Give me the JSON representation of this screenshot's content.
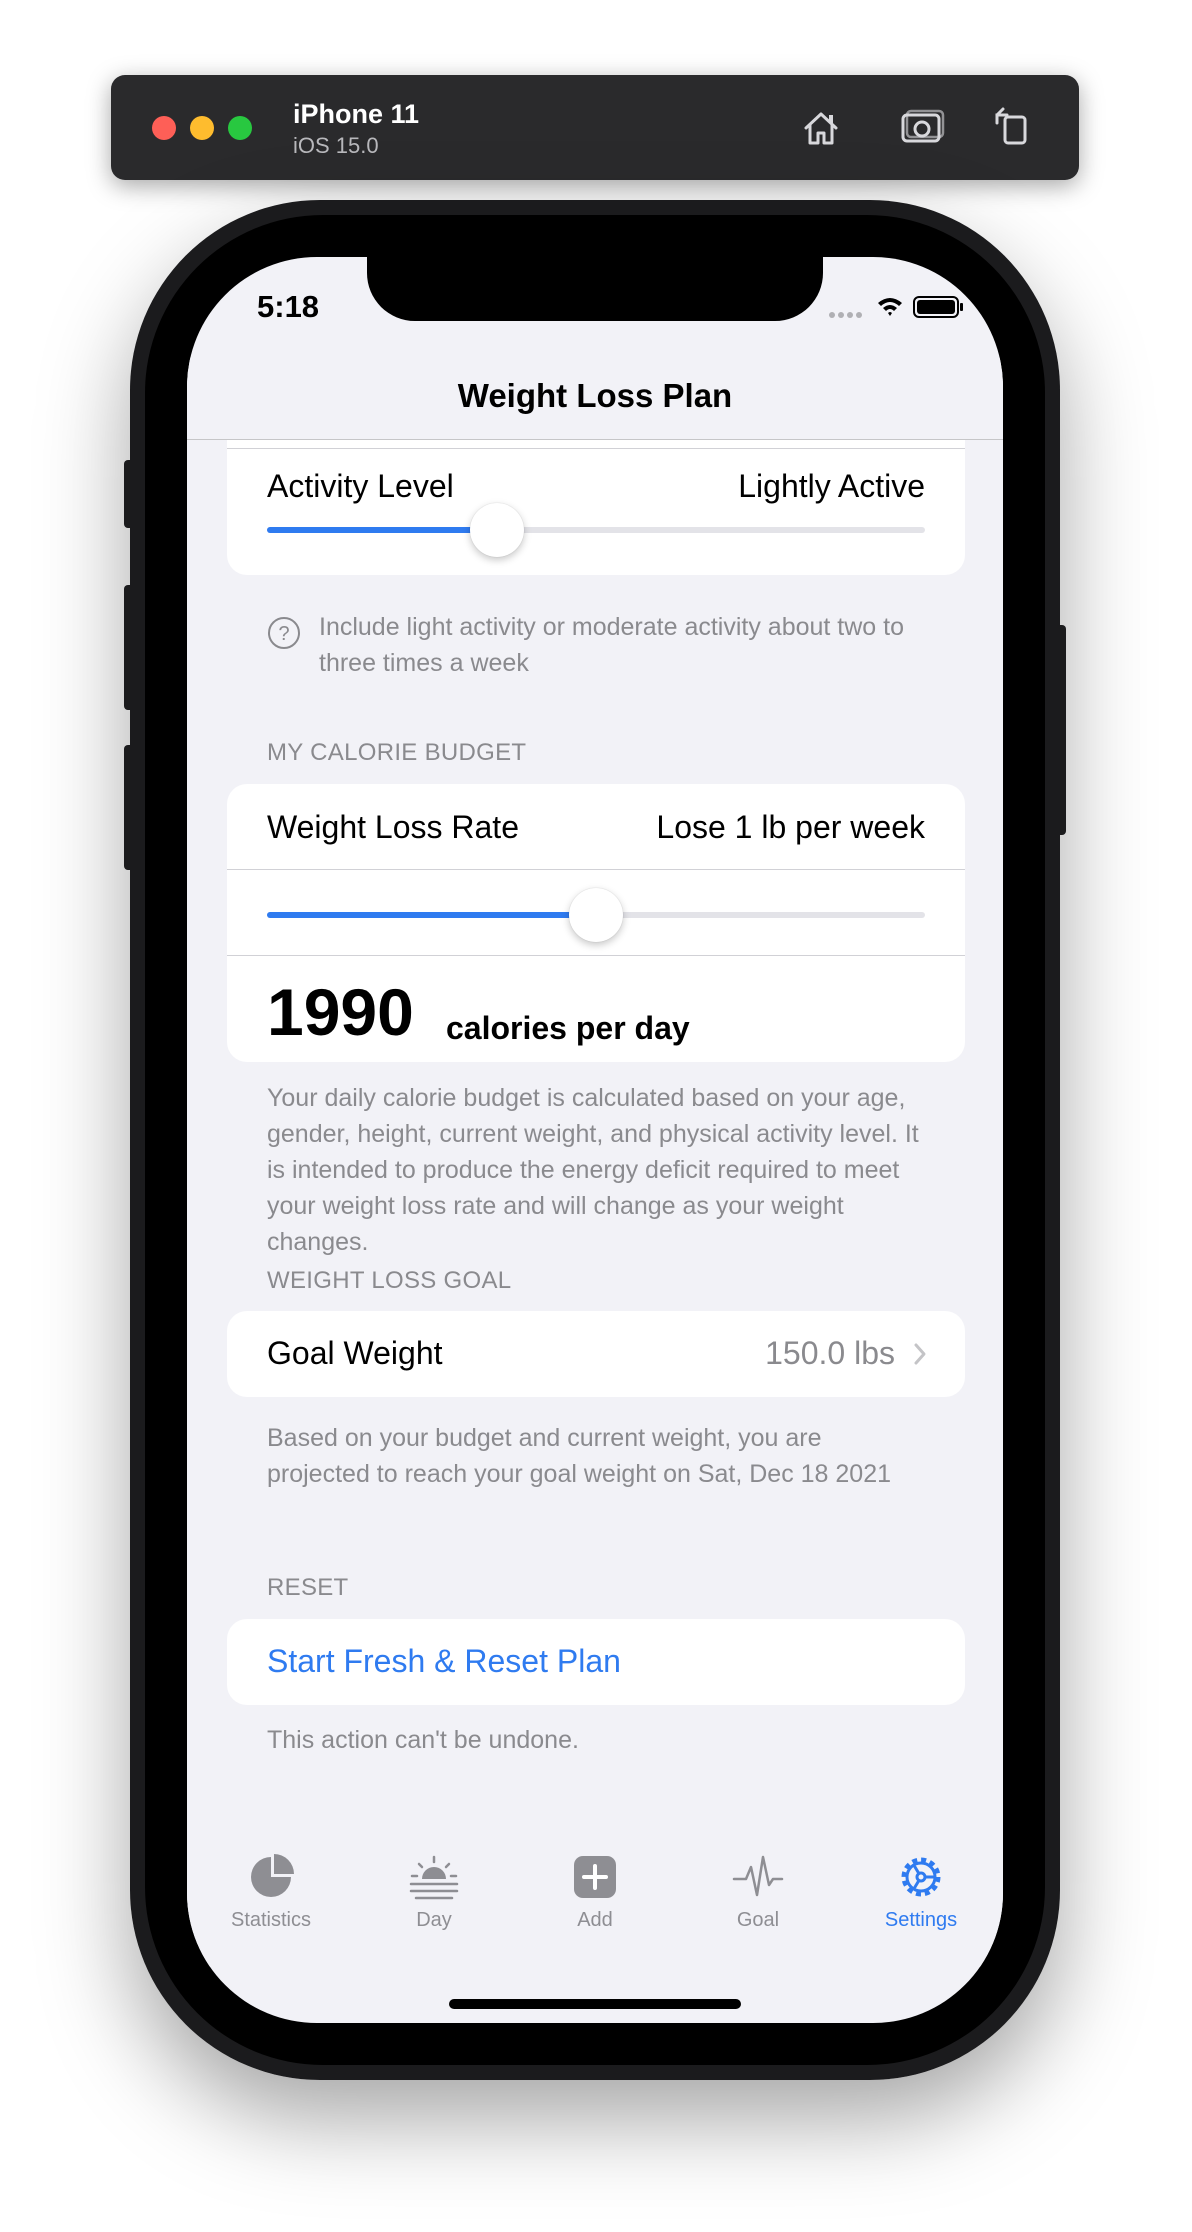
{
  "simulator": {
    "device_name": "iPhone 11",
    "os_version": "iOS 15.0",
    "buttons": [
      "home-icon",
      "screenshot-icon",
      "rotate-icon"
    ]
  },
  "status_bar": {
    "time": "5:18"
  },
  "nav": {
    "title": "Weight Loss Plan"
  },
  "activity": {
    "label": "Activity Level",
    "value": "Lightly Active",
    "slider_fraction": 0.35,
    "help_icon": "question-circle-icon",
    "help_text": "Include light activity or moderate activity about two to three times a week"
  },
  "calorie_budget": {
    "header": "MY CALORIE BUDGET",
    "rate_label": "Weight Loss Rate",
    "rate_value": "Lose 1 lb per week",
    "slider_fraction": 0.5,
    "calories": "1990",
    "calories_unit": "calories per day",
    "footnote": "Your daily calorie budget is calculated based on your age, gender, height, current weight, and physical activity level. It is intended to produce the energy deficit required to meet your weight loss rate and will change as your weight changes."
  },
  "goal": {
    "header": "WEIGHT LOSS GOAL",
    "label": "Goal Weight",
    "value": "150.0 lbs",
    "footnote": "Based on your budget and current weight, you are projected to reach your goal weight on Sat, Dec 18 2021"
  },
  "reset": {
    "header": "RESET",
    "button_label": "Start Fresh & Reset Plan",
    "footnote": "This action can't be undone."
  },
  "tabs": [
    {
      "label": "Statistics",
      "icon": "pie-chart-icon",
      "active": false
    },
    {
      "label": "Day",
      "icon": "sunrise-icon",
      "active": false
    },
    {
      "label": "Add",
      "icon": "plus-square-icon",
      "active": false
    },
    {
      "label": "Goal",
      "icon": "heartbeat-icon",
      "active": false
    },
    {
      "label": "Settings",
      "icon": "gear-icon",
      "active": true
    }
  ],
  "colors": {
    "accent": "#2f7bf0",
    "background": "#f2f2f7",
    "secondary_text": "#8a8a8e",
    "tab_inactive": "#8e8e93"
  }
}
